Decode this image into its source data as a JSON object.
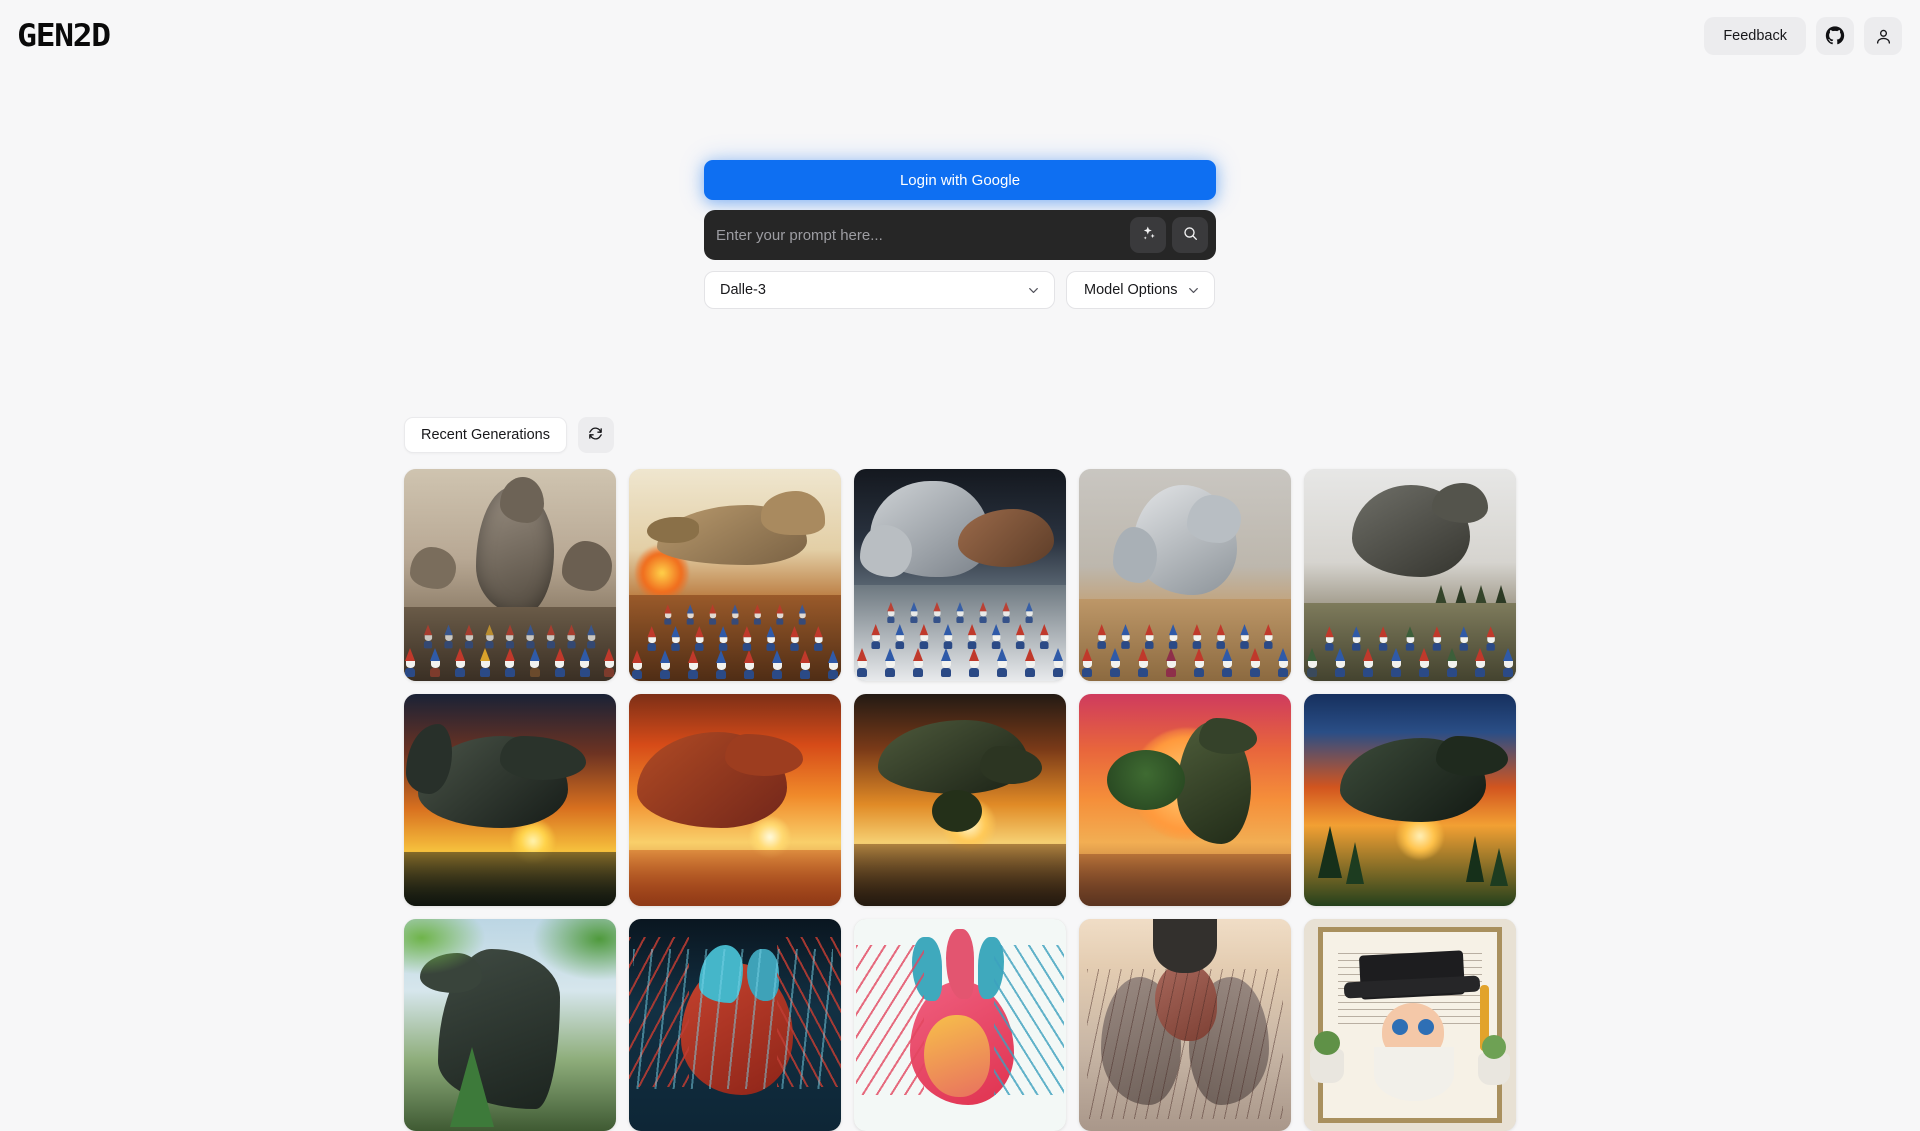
{
  "app": {
    "logo_text": "GEN2D",
    "background_color": "#f7f7f8",
    "accent_color": "#0e6ff2"
  },
  "header": {
    "feedback_label": "Feedback",
    "github_icon": "github-icon",
    "account_icon": "user-icon"
  },
  "auth": {
    "login_label": "Login with Google"
  },
  "prompt": {
    "placeholder": "Enter your prompt here...",
    "value": "",
    "enhance_icon": "sparkles-icon",
    "submit_icon": "search-icon"
  },
  "controls": {
    "model_value": "Dalle-3",
    "model_options_label": "Model Options",
    "chevron_icon": "chevron-down-icon"
  },
  "gallery": {
    "tab_label": "Recent Generations",
    "refresh_icon": "refresh-icon",
    "columns": 5,
    "items": [
      {
        "alt": "Armored tyrannosaurus towering over an army of garden gnomes on a dusty battlefield",
        "theme": "armored-dino-gnomes-dust"
      },
      {
        "alt": "Scaly armored dinosaur charging past burning ruins toward red-hatted gnome ranks",
        "theme": "armored-dino-gnomes-fire"
      },
      {
        "alt": "Plate-armored dinosaur miniature facing rows of painted gnome figurines",
        "theme": "armored-dino-gnomes-miniature"
      },
      {
        "alt": "Stone-armored dinosaur model standing before tabletop gnome army on sand",
        "theme": "armored-dino-gnomes-tabletop"
      },
      {
        "alt": "Dark scaled dinosaur striding past conifer trees and gnome warriors",
        "theme": "armored-dino-gnomes-forest"
      },
      {
        "alt": "Roaring tyrannosaurus rex silhouetted against a fiery orange sunset",
        "theme": "trex-sunset-orange"
      },
      {
        "alt": "Tyrannosaurus rex in red sunset haze above a mirrored shoreline",
        "theme": "trex-sunset-red"
      },
      {
        "alt": "Tyrannosaurus leaning over a lone tree with the sun setting behind it",
        "theme": "trex-sunset-tree"
      },
      {
        "alt": "Tyrannosaurus beside a broad green tree with a giant setting sun disc",
        "theme": "trex-sunset-disc"
      },
      {
        "alt": "Tyrannosaurus roaring in a pine forest under a blue and orange sky",
        "theme": "trex-forest-night"
      },
      {
        "alt": "Long-necked dinosaur browsing treetops in a sunlit jungle",
        "theme": "sauropod-jungle"
      },
      {
        "alt": "Medical illustration of a human heart with blue and red vessels in the chest",
        "theme": "anatomy-heart-vessels"
      },
      {
        "alt": "Colorful anatomical drawing of a heart with pink and teal arteries",
        "theme": "anatomy-heart-illustration"
      },
      {
        "alt": "Sepia anatomical rendering of heart and lungs with fine vasculature",
        "theme": "anatomy-heart-sepia"
      },
      {
        "alt": "Cartoon gnome wearing a graduation cap in front of a framed diploma",
        "theme": "gnome-graduation"
      }
    ]
  }
}
